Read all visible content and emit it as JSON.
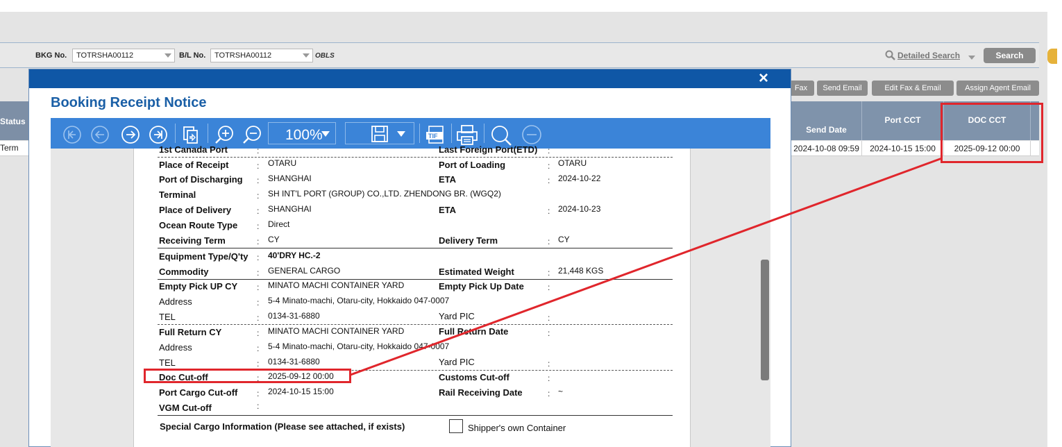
{
  "search_bar": {
    "bkg_label": "BKG No.",
    "bkg_value": "TOTRSHA00112",
    "bl_label": "B/L No.",
    "bl_value": "TOTRSHA00112",
    "bl_tag": "OBLS",
    "detailed_search": "Detailed Search",
    "search_button": "Search"
  },
  "left_grid": {
    "status_header": "Status",
    "status_cell": "Term"
  },
  "actions": [
    "Fax",
    "Send Email",
    "Edit Fax & Email",
    "Assign Agent Email"
  ],
  "grid": {
    "headers": [
      "Send Date",
      "Port CCT",
      "DOC CCT"
    ],
    "row": [
      "2024-10-08 09:59",
      "2024-10-15 15:00",
      "2025-09-12 00:00"
    ]
  },
  "modal": {
    "close": "×",
    "title": "Booking Receipt Notice",
    "zoom": "100%",
    "icons": [
      "first-page-icon",
      "prev-page-icon",
      "next-page-icon",
      "last-page-icon",
      "export-icon",
      "zoom-in-icon",
      "zoom-out-icon",
      "save-icon",
      "tif-icon",
      "print-icon",
      "search-icon",
      "remove-icon"
    ]
  },
  "document": {
    "top_partial_left": "1st Canada Port",
    "top_partial_right": "Last Foreign Port(ETD)",
    "place_of_receipt": "Place of Receipt",
    "place_of_receipt_value": "OTARU",
    "port_of_loading": "Port of Loading",
    "port_of_loading_value": "OTARU",
    "port_of_discharging": "Port of Discharging",
    "port_of_discharging_value": "SHANGHAI",
    "eta1_label": "ETA",
    "eta1_value": "2024-10-22",
    "terminal": "Terminal",
    "terminal_value": "SH INT'L PORT (GROUP) CO.,LTD. ZHENDONG BR. (WGQ2)",
    "place_of_delivery": "Place of Delivery",
    "place_of_delivery_value": "SHANGHAI",
    "eta2_label": "ETA",
    "eta2_value": "2024-10-23",
    "ocean_route_type": "Ocean Route Type",
    "ocean_route_type_value": "Direct",
    "receiving_term": "Receiving Term",
    "receiving_term_value": "CY",
    "delivery_term": "Delivery Term",
    "delivery_term_value": "CY",
    "equipment": "Equipment Type/Q'ty",
    "equipment_value": "40'DRY HC.-2",
    "commodity": "Commodity",
    "commodity_value": "GENERAL CARGO",
    "estimated_weight": "Estimated Weight",
    "estimated_weight_value": "21,448 KGS",
    "empty_pickup_cy": "Empty Pick UP CY",
    "empty_pickup_cy_value": "MINATO MACHI CONTAINER YARD",
    "empty_pickup_date": "Empty Pick Up Date",
    "address1_label": "Address",
    "address1_value": "5-4 Minato-machi, Otaru-city, Hokkaido 047-0007",
    "tel1_label": "TEL",
    "tel1_value": "0134-31-6880",
    "yard_pic1": "Yard PIC",
    "full_return_cy": "Full Return CY",
    "full_return_cy_value": "MINATO MACHI CONTAINER YARD",
    "full_return_date": "Full Return Date",
    "address2_label": "Address",
    "address2_value": "5-4 Minato-machi, Otaru-city, Hokkaido 047-0007",
    "tel2_label": "TEL",
    "tel2_value": "0134-31-6880",
    "yard_pic2": "Yard PIC",
    "doc_cutoff": "Doc Cut-off",
    "doc_cutoff_value": "2025-09-12 00:00",
    "customs_cutoff": "Customs Cut-off",
    "port_cargo_cutoff": "Port Cargo Cut-off",
    "port_cargo_cutoff_value": "2024-10-15 15:00",
    "rail_receiving_date": "Rail Receiving Date",
    "rail_receiving_date_value": "~",
    "vgm_cutoff": "VGM Cut-off",
    "special_cargo": "Special Cargo Information (Please see attached, if exists)",
    "shippers_container": "Shipper's own Container",
    "colon": ":"
  },
  "annotation_color": "#e0262c"
}
